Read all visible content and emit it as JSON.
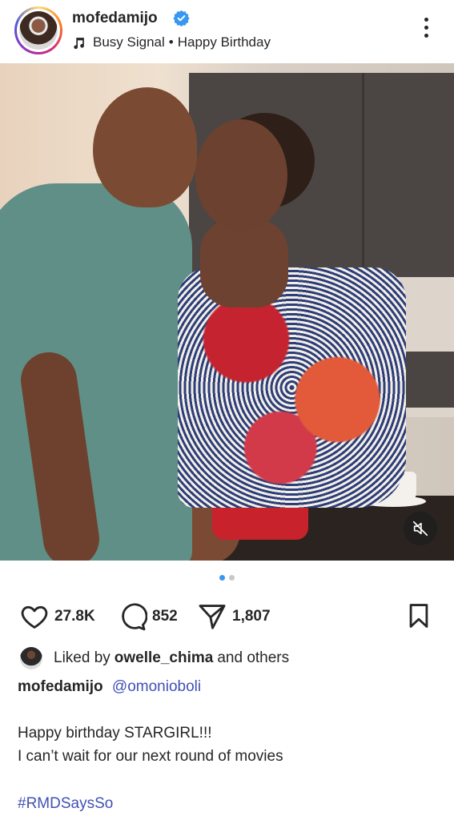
{
  "post_header": {
    "username": "mofedamijo",
    "music": {
      "artist": "Busy Signal",
      "separator": "•",
      "song": "Happy Birthday"
    },
    "icons": {
      "verified": "verified-badge-icon",
      "music": "music-note-icon",
      "menu": "more-options-icon"
    }
  },
  "media": {
    "carousel": {
      "current": 1,
      "total": 2
    },
    "mute_icon": "speaker-muted-icon",
    "accent_color": "#3897f0"
  },
  "actions": {
    "likes": "27.8K",
    "comments": "852",
    "shares": "1,807",
    "icons": {
      "like": "heart-icon",
      "comment": "comment-icon",
      "share": "send-icon",
      "save": "bookmark-icon"
    }
  },
  "liked_by": {
    "prefix": "Liked by",
    "user": "owelle_chima",
    "suffix": "and others"
  },
  "caption": {
    "username": "mofedamijo",
    "mention": "@omonioboli",
    "line1": "Happy birthday STARGIRL!!!",
    "line2": "I can’t wait for our next round of movies",
    "hashtag": "#RMDSaysSo",
    "link_color": "#3f51b5"
  }
}
